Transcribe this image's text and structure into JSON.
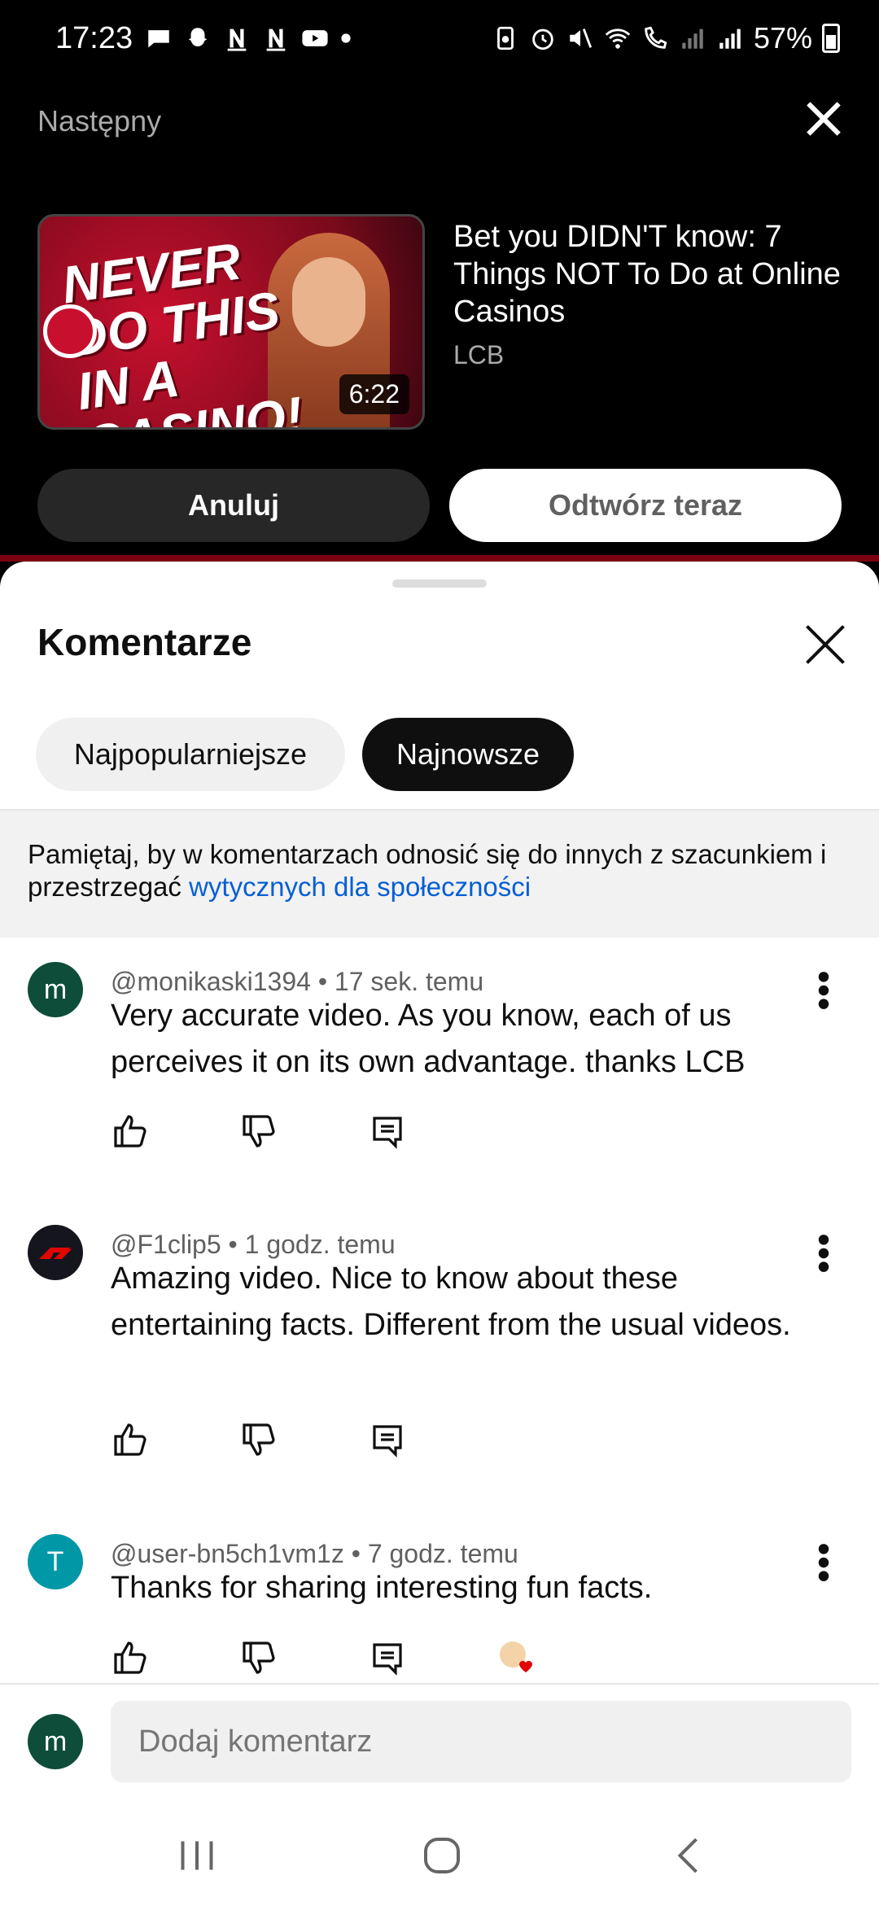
{
  "status_bar": {
    "time": "17:23",
    "battery": "57%",
    "icons_left": [
      "chat-bubble-icon",
      "snapchat-icon",
      "n-icon",
      "n-icon",
      "youtube-icon",
      "dot-icon"
    ],
    "icons_right": [
      "recycle-icon",
      "alarm-icon",
      "mute-icon",
      "wifi-icon",
      "wifi-call-icon",
      "signal-icon",
      "signal-r-icon"
    ]
  },
  "up_next": {
    "header": "Następny",
    "video": {
      "title": "Bet you DIDN'T know: 7 Things NOT To Do at Online Casinos",
      "channel": "LCB",
      "duration": "6:22",
      "thumbnail_text": "NEVER DO THIS IN A CASINO!"
    },
    "cancel_label": "Anuluj",
    "play_label": "Odtwórz teraz"
  },
  "comments_sheet": {
    "title": "Komentarze",
    "sort_chips": [
      {
        "label": "Najpopularniejsze",
        "selected": false
      },
      {
        "label": "Najnowsze",
        "selected": true
      }
    ],
    "notice": {
      "text": "Pamiętaj, by w komentarzach odnosić się do innych z szacunkiem i przestrzegać ",
      "link": "wytycznych dla społeczności"
    },
    "comments": [
      {
        "author": "@monikaski1394",
        "time": "17 sek. temu",
        "text": "Very accurate video. As you know, each of us perceives it on its own advantage. thanks LCB",
        "avatar_letter": "m",
        "avatar_color": "#0d4d3a"
      },
      {
        "author": "@F1clip5",
        "time": "1 godz. temu",
        "text": "Amazing video. Nice to know about these entertaining facts. Different from the usual videos.",
        "avatar_letter": "",
        "avatar_color": "#15151e"
      },
      {
        "author": "@user-bn5ch1vm1z",
        "time": "7 godz. temu",
        "text": "Thanks for sharing interesting fun facts.",
        "avatar_letter": "T",
        "avatar_color": "#0097a7"
      }
    ],
    "separator": " • ",
    "add_comment": {
      "avatar_letter": "m",
      "placeholder": "Dodaj komentarz"
    }
  },
  "colors": {
    "accent_link": "#065fd4",
    "brand_red": "#c8102e"
  }
}
